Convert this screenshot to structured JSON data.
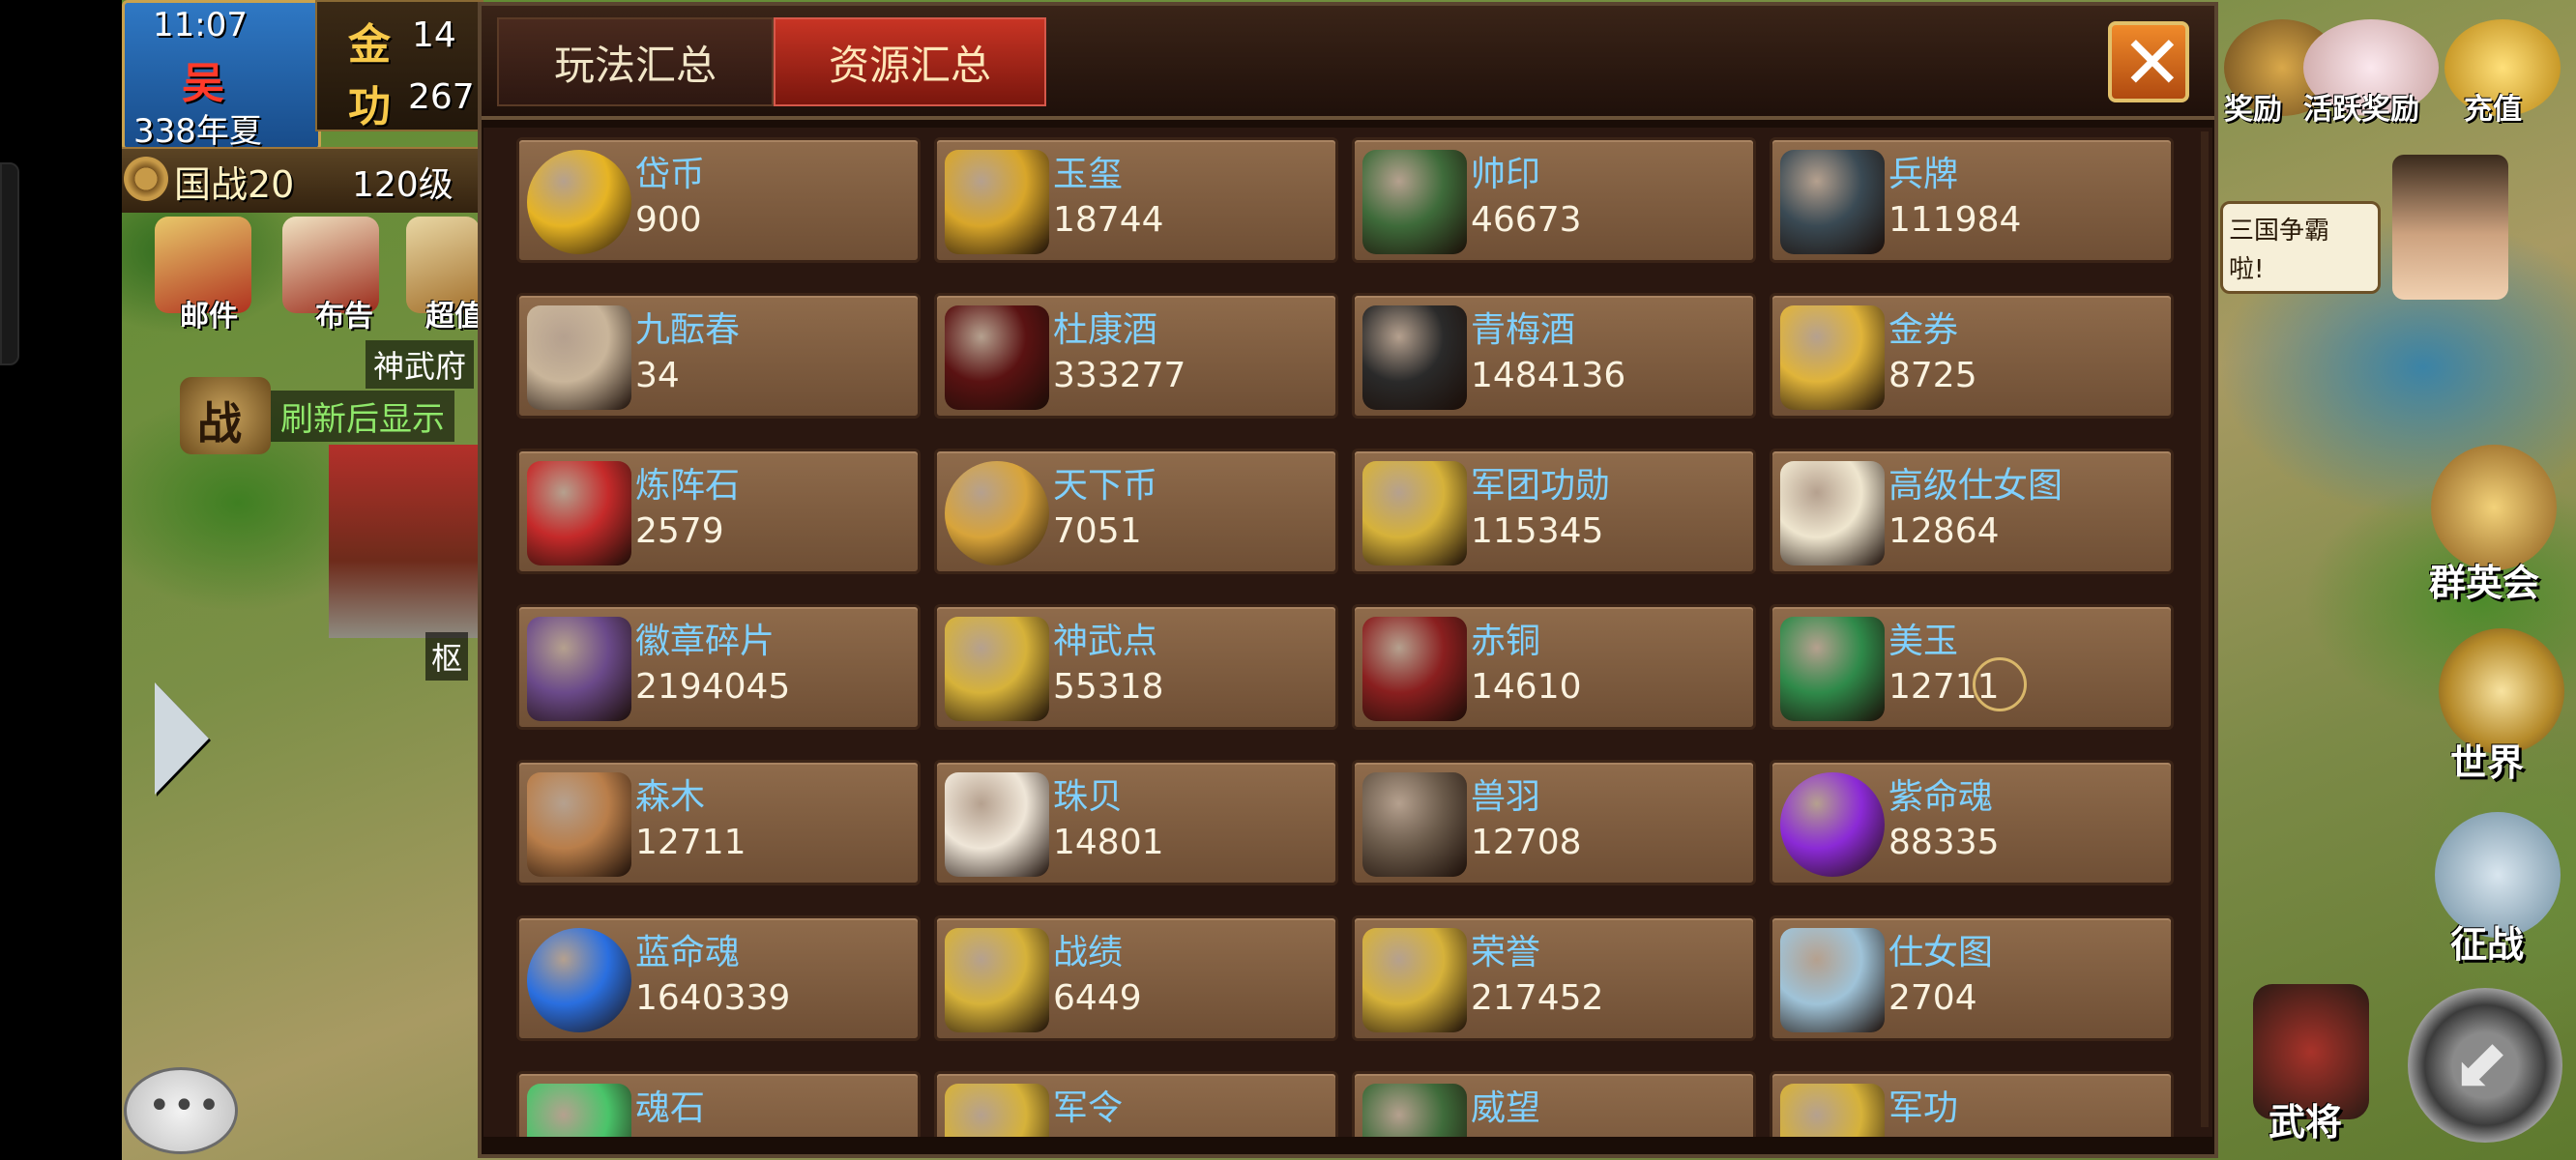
{
  "hud": {
    "time": "11:07",
    "kingdom": "吴",
    "season": "338年夏",
    "gold_label": "金",
    "gold_value": "14",
    "merit_label": "功",
    "merit_value": "267",
    "war_label": "国战20",
    "level": "120级",
    "mail": "邮件",
    "notice": "布告",
    "super": "超值",
    "shenwu": "神武府",
    "war_badge": "战",
    "refresh": "刷新后显示",
    "tag": "枢"
  },
  "right_hud": {
    "reward": "奖励",
    "active_reward": "活跃奖励",
    "recharge": "充值",
    "bubble": "三国争霸\n啦!",
    "heroes_club": "群英会",
    "world": "世界",
    "expedition": "征战",
    "generals": "武将"
  },
  "tabs": [
    "玩法汇总",
    "资源汇总"
  ],
  "resources": [
    {
      "name": "岱币",
      "value": "900",
      "icon": "coin-icon",
      "color": "#e6b424"
    },
    {
      "name": "玉玺",
      "value": "18744",
      "icon": "jade-seal-icon",
      "color": "#d8a62a"
    },
    {
      "name": "帅印",
      "value": "46673",
      "icon": "commander-seal-icon",
      "color": "#3e6b3a"
    },
    {
      "name": "兵牌",
      "value": "111984",
      "icon": "army-token-icon",
      "color": "#3a4a54"
    },
    {
      "name": "九酝春",
      "value": "34",
      "icon": "wine-jar-icon",
      "color": "#c9b59a"
    },
    {
      "name": "杜康酒",
      "value": "333277",
      "icon": "wine-pot-icon",
      "color": "#5a1212"
    },
    {
      "name": "青梅酒",
      "value": "1484136",
      "icon": "plum-wine-icon",
      "color": "#2a2a2a"
    },
    {
      "name": "金券",
      "value": "8725",
      "icon": "gold-ticket-icon",
      "color": "#e0b43a"
    },
    {
      "name": "炼阵石",
      "value": "2579",
      "icon": "red-gem-icon",
      "color": "#c52a2a"
    },
    {
      "name": "天下币",
      "value": "7051",
      "icon": "copper-coin-icon",
      "color": "#d8a43a"
    },
    {
      "name": "军团功勋",
      "value": "115345",
      "icon": "legion-merit-icon",
      "color": "#d6b23a"
    },
    {
      "name": "高级仕女图",
      "value": "12864",
      "icon": "scroll-icon",
      "color": "#efe6cf"
    },
    {
      "name": "徽章碎片",
      "value": "2194045",
      "icon": "badge-shard-icon",
      "color": "#6b4a8a"
    },
    {
      "name": "神武点",
      "value": "55318",
      "icon": "shenwu-point-icon",
      "color": "#d6b23a"
    },
    {
      "name": "赤铜",
      "value": "14610",
      "icon": "red-copper-icon",
      "color": "#8a1f1f"
    },
    {
      "name": "美玉",
      "value": "12711",
      "icon": "jade-icon",
      "color": "#2f8a4a"
    },
    {
      "name": "森木",
      "value": "12711",
      "icon": "wood-icon",
      "color": "#b97e4a"
    },
    {
      "name": "珠贝",
      "value": "14801",
      "icon": "pearl-icon",
      "color": "#efe6d8"
    },
    {
      "name": "兽羽",
      "value": "12708",
      "icon": "feather-icon",
      "color": "#6a5a4a"
    },
    {
      "name": "紫命魂",
      "value": "88335",
      "icon": "purple-orb-icon",
      "color": "#8b2ad6"
    },
    {
      "name": "蓝命魂",
      "value": "1640339",
      "icon": "blue-orb-icon",
      "color": "#2a6fe0"
    },
    {
      "name": "战绩",
      "value": "6449",
      "icon": "battle-record-icon",
      "color": "#d6b23a"
    },
    {
      "name": "荣誉",
      "value": "217452",
      "icon": "honor-icon",
      "color": "#d6b23a"
    },
    {
      "name": "仕女图",
      "value": "2704",
      "icon": "scroll-blue-icon",
      "color": "#9fc3d8"
    },
    {
      "name": "魂石",
      "value": "",
      "icon": "soul-stone-icon",
      "color": "#4ac46a"
    },
    {
      "name": "军令",
      "value": "",
      "icon": "military-order-icon",
      "color": "#d6b23a"
    },
    {
      "name": "威望",
      "value": "",
      "icon": "prestige-icon",
      "color": "#3e6b3a"
    },
    {
      "name": "军功",
      "value": "",
      "icon": "military-merit-icon",
      "color": "#d6b23a"
    }
  ]
}
